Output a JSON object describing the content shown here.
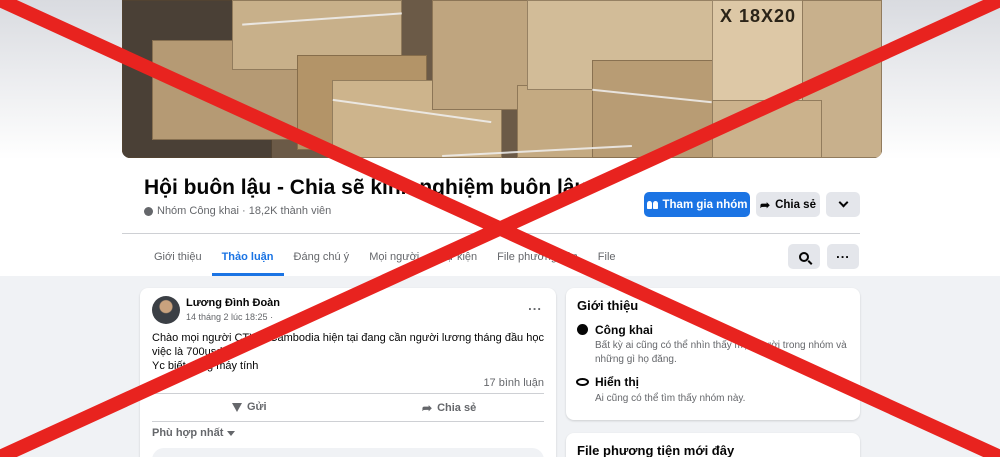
{
  "group": {
    "title": "Hội buôn lậu - Chia sẽ kinh nghiệm buôn lậu.",
    "meta": "Nhóm Công khai · 18,2K thành viên",
    "cover_stamp": "X 18X20"
  },
  "actions": {
    "join_label": "Tham gia nhóm",
    "share_label": "Chia sẻ"
  },
  "tabs": [
    {
      "label": "Giới thiệu",
      "active": false
    },
    {
      "label": "Thảo luận",
      "active": true
    },
    {
      "label": "Đáng chú ý",
      "active": false
    },
    {
      "label": "Mọi người",
      "active": false
    },
    {
      "label": "Sự kiện",
      "active": false
    },
    {
      "label": "File phương tiện",
      "active": false
    },
    {
      "label": "File",
      "active": false
    }
  ],
  "post": {
    "author": "Lương Đình Đoàn",
    "time": "14 tháng 2 lúc 18:25 ·",
    "lines": [
      "Chào mọi người CTY ở Cambodia hiện tại đang cần người lương tháng đầu học",
      "việc là 700usd",
      "Yc biết dùng máy tính"
    ],
    "comments": "17 bình luận",
    "send_label": "Gửi",
    "share_label": "Chia sẻ",
    "sort_label": "Phù hợp nhất"
  },
  "about": {
    "title": "Giới thiệu",
    "public_title": "Công khai",
    "public_desc": "Bất kỳ ai cũng có thể nhìn thấy mọi người trong nhóm và những gì họ đăng.",
    "visible_title": "Hiển thị",
    "visible_desc": "Ai cũng có thể tìm thấy nhóm này."
  },
  "media": {
    "title": "File phương tiện mới đây"
  },
  "colors": {
    "accent": "#1b74e4",
    "overlay_cross": "#e8231f"
  }
}
